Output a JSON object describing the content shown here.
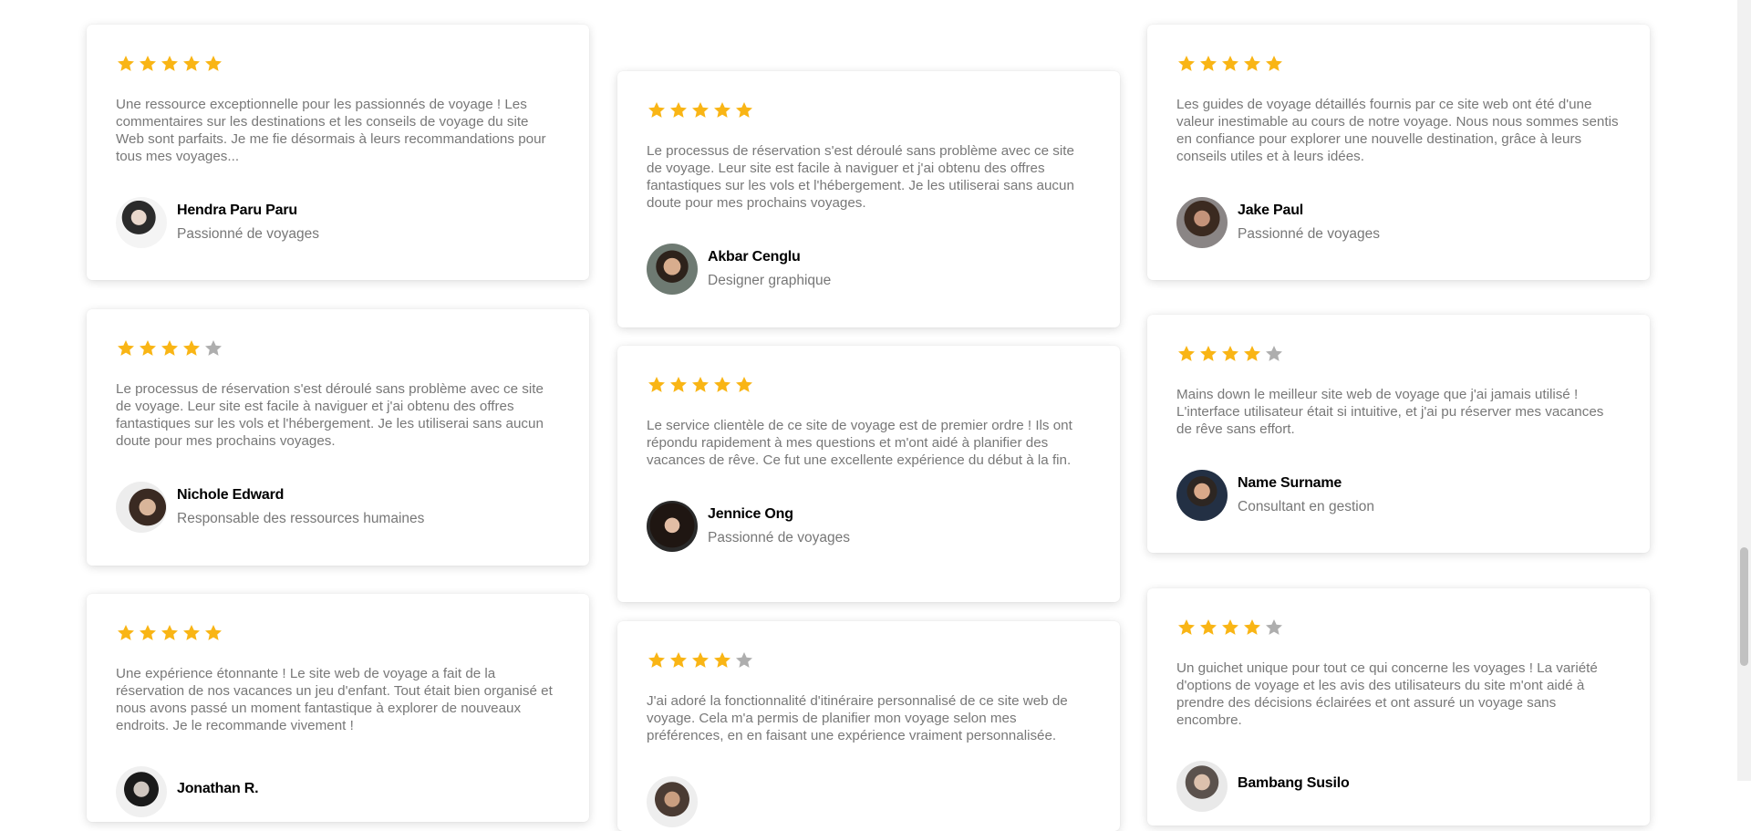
{
  "colors": {
    "star_filled": "#F9B515",
    "star_empty": "#AEAEAE",
    "name": "#000000",
    "text": "#787878"
  },
  "testimonials": [
    {
      "rating": 5,
      "text": "Une ressource exceptionnelle pour les passionnés de voyage ! Les commentaires sur les destinations et les conseils de voyage du site Web sont parfaits. Je me fie désormais à leurs recommandations pour tous mes voyages...",
      "name": "Hendra Paru Paru",
      "role": "Passionné de voyages",
      "avatar_icon": "person-avatar"
    },
    {
      "rating": 5,
      "text": "Le processus de réservation s'est déroulé sans problème avec ce site de voyage. Leur site est facile à naviguer et j'ai obtenu des offres fantastiques sur les vols et l'hébergement. Je les utiliserai sans aucun doute pour mes prochains voyages.",
      "name": "Akbar Cenglu",
      "role": "Designer graphique",
      "avatar_icon": "person-avatar"
    },
    {
      "rating": 5,
      "text": "Les guides de voyage détaillés fournis par ce site web ont été d'une valeur inestimable au cours de notre voyage. Nous nous sommes sentis en confiance pour explorer une nouvelle destination, grâce à leurs conseils utiles et à leurs idées.",
      "name": "Jake Paul",
      "role": "Passionné de voyages",
      "avatar_icon": "person-avatar"
    },
    {
      "rating": 4,
      "text": "Le processus de réservation s'est déroulé sans problème avec ce site de voyage. Leur site est facile à naviguer et j'ai obtenu des offres fantastiques sur les vols et l'hébergement. Je les utiliserai sans aucun doute pour mes prochains voyages.",
      "name": "Nichole Edward",
      "role": "Responsable des ressources humaines",
      "avatar_icon": "person-avatar"
    },
    {
      "rating": 5,
      "text": "Le service clientèle de ce site de voyage est de premier ordre ! Ils ont répondu rapidement à mes questions et m'ont aidé à planifier des vacances de rêve. Ce fut une excellente expérience du début à la fin.",
      "name": "Jennice Ong",
      "role": "Passionné de voyages",
      "avatar_icon": "person-avatar"
    },
    {
      "rating": 4,
      "text": "Mains down le meilleur site web de voyage que j'ai jamais utilisé ! L'interface utilisateur était si intuitive, et j'ai pu réserver mes vacances de rêve sans effort.",
      "name": "Name Surname",
      "role": "Consultant en gestion",
      "avatar_icon": "person-avatar"
    },
    {
      "rating": 5,
      "text": "Une expérience étonnante ! Le site web de voyage a fait de la réservation de nos vacances un jeu d'enfant. Tout était bien organisé et nous avons passé un moment fantastique à explorer de nouveaux endroits. Je le recommande vivement !",
      "name": "Jonathan R.",
      "role": "",
      "avatar_icon": "person-avatar"
    },
    {
      "rating": 4,
      "text": "J'ai adoré la fonctionnalité d'itinéraire personnalisé de ce site web de voyage. Cela m'a permis de planifier mon voyage selon mes préférences, en en faisant une expérience vraiment personnalisée.",
      "name": "",
      "role": "",
      "avatar_icon": "person-avatar"
    },
    {
      "rating": 4,
      "text": "Un guichet unique pour tout ce qui concerne les voyages ! La variété d'options de voyage et les avis des utilisateurs du site m'ont aidé à prendre des décisions éclairées et ont assuré un voyage sans encombre.",
      "name": "Bambang Susilo",
      "role": "",
      "avatar_icon": "person-avatar"
    }
  ]
}
